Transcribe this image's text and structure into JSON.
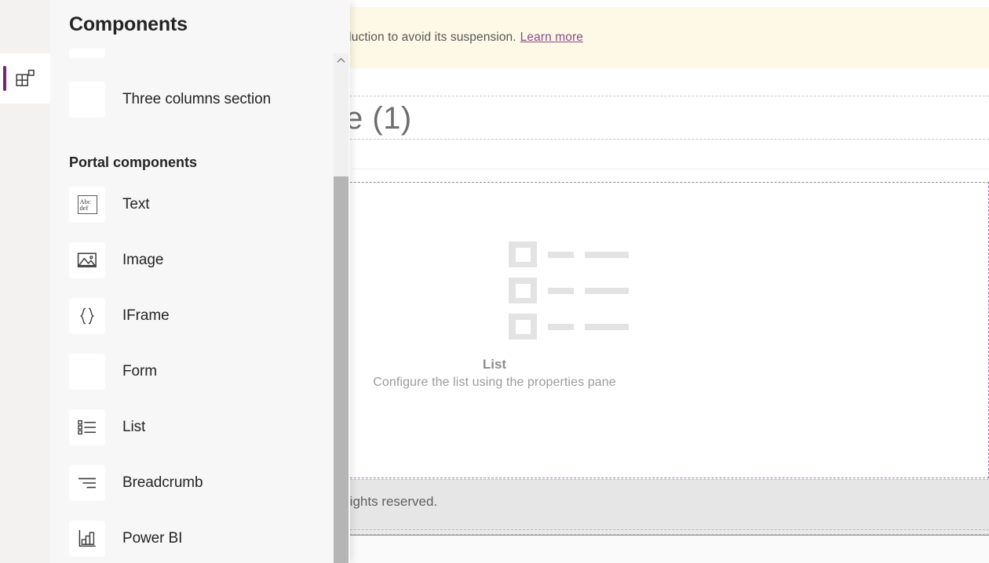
{
  "notice": {
    "text": "onvert your portal to production to avoid its suspension.",
    "link_label": "Learn more",
    "background": "#fdf9e6",
    "link_color": "#8a4d8a"
  },
  "rail": {
    "active_item": {
      "name": "components",
      "icon": "components-grid-icon"
    },
    "indicator_color": "#742774"
  },
  "panel": {
    "title": "Components",
    "groups": [
      {
        "heading": "",
        "items": [
          {
            "label": "Three columns section",
            "icon": "three-columns-section-icon"
          }
        ]
      },
      {
        "heading": "Portal components",
        "items": [
          {
            "label": "Text",
            "icon": "text-abc-icon"
          },
          {
            "label": "Image",
            "icon": "image-picture-icon"
          },
          {
            "label": "IFrame",
            "icon": "iframe-braces-icon"
          },
          {
            "label": "Form",
            "icon": "form-icon"
          },
          {
            "label": "List",
            "icon": "list-bullets-icon"
          },
          {
            "label": "Breadcrumb",
            "icon": "breadcrumb-lines-icon"
          },
          {
            "label": "Power BI",
            "icon": "power-bi-chart-icon"
          }
        ]
      }
    ]
  },
  "canvas": {
    "page_title": "e (1)",
    "selected_section": {
      "border_color": "#9b7fa6",
      "component": {
        "placeholder_title": "List",
        "placeholder_subtitle": "Configure the list using the properties pane"
      }
    },
    "footer": {
      "text": "rights reserved."
    }
  },
  "scrollbar": {
    "up_arrow_icon": "chevron-up-icon",
    "thumb_color": "#b5b5b5"
  }
}
